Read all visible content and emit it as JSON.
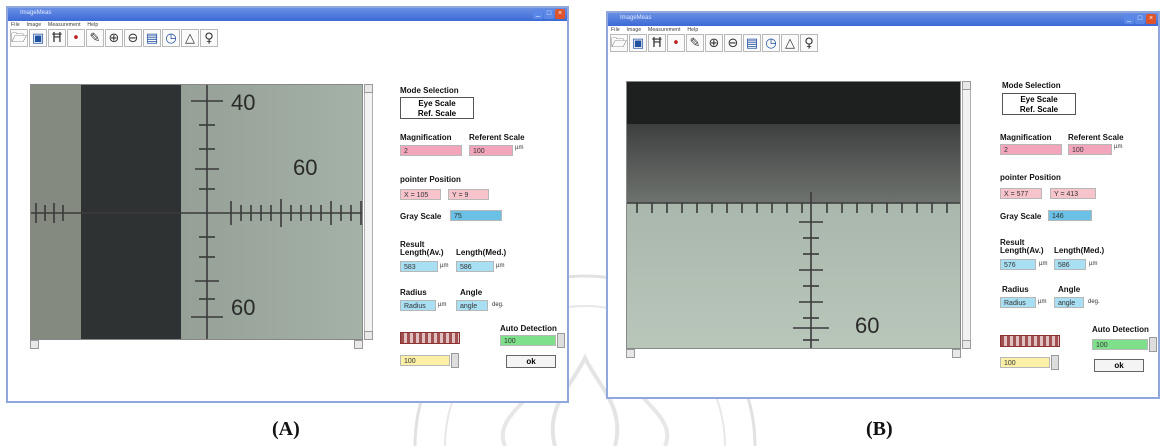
{
  "panel_a": {
    "title": "ImageMeas",
    "menu": [
      "File",
      "Image",
      "Measurement",
      "Help"
    ],
    "scale_numbers": [
      "40",
      "60",
      "60"
    ],
    "mode_title": "Mode Selection",
    "mode_opt1": "Eye Scale",
    "mode_opt2": "Ref. Scale",
    "mag_label": "Magnification",
    "ref_label": "Referent Scale",
    "mag_value": "2",
    "ref_value": "100",
    "ref_unit": "µm",
    "pointer_label": "pointer Position",
    "x_value": "X = 105",
    "y_value": "Y = 9",
    "gray_label": "Gray Scale",
    "gray_value": "75",
    "result_label": "Result",
    "len_av_label": "Length(Av.)",
    "len_med_label": "Length(Med.)",
    "len_av_value": "583",
    "len_med_value": "586",
    "unit_um": "µm",
    "radius_label": "Radius",
    "angle_label": "Angle",
    "radius_value": "Radius",
    "angle_value": "angle",
    "deg_unit": "deg.",
    "auto_label": "Auto Detection",
    "auto_value": "100",
    "bottom_value": "100",
    "ok_label": "ok"
  },
  "panel_b": {
    "title": "ImageMeas",
    "menu": [
      "File",
      "Image",
      "Measurement",
      "Help"
    ],
    "scale_numbers": [
      "60"
    ],
    "mode_title": "Mode Selection",
    "mode_opt1": "Eye Scale",
    "mode_opt2": "Ref. Scale",
    "mag_label": "Magnification",
    "ref_label": "Referent Scale",
    "mag_value": "2",
    "ref_value": "100",
    "ref_unit": "µm",
    "pointer_label": "pointer Position",
    "x_value": "X = 577",
    "y_value": "Y = 413",
    "gray_label": "Gray Scale",
    "gray_value": "146",
    "result_label": "Result",
    "len_av_label": "Length(Av.)",
    "len_med_label": "Length(Med.)",
    "len_av_value": "576",
    "len_med_value": "586",
    "unit_um": "µm",
    "radius_label": "Radius",
    "angle_label": "Angle",
    "radius_value": "Radius",
    "angle_value": "angle",
    "deg_unit": "deg.",
    "auto_label": "Auto Detection",
    "auto_value": "100",
    "bottom_value": "100",
    "ok_label": "ok"
  },
  "captions": {
    "a": "(A)",
    "b": "(B)"
  },
  "toolbar_icons": [
    "open-folder-icon",
    "save-icon",
    "measure-h-icon",
    "point-icon",
    "eraser-icon",
    "zoom-in-icon",
    "zoom-out-icon",
    "monitor-icon",
    "gauge-icon",
    "triangle-icon",
    "bulb-icon"
  ],
  "colors": {
    "titlebar": "#3b6ad6",
    "pink_field": "#f3a6bb",
    "cyan_field": "#a9dff3",
    "green_field": "#7ee08a",
    "yellow_field": "#fbf0a6"
  }
}
